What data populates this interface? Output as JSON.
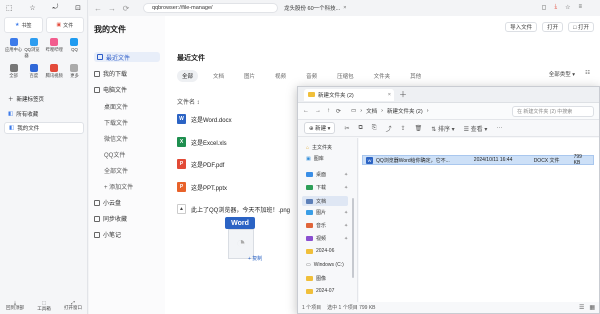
{
  "browser": {
    "address": "qqbrowser://file-manage/",
    "tab_title": "龙头股份 60一个科技...",
    "topright": {
      "wallet": "◻",
      "download": "⤓",
      "history": "☆",
      "menu": "≡"
    }
  },
  "sidebar": {
    "top_icons": [
      "⬚",
      "☆",
      "⤾",
      "⊡"
    ],
    "big_buttons": [
      {
        "icon": "★",
        "label": "书签"
      },
      {
        "icon": "▣",
        "label": "文件"
      }
    ],
    "row1": [
      {
        "label": "应用中心",
        "color": "#3d7bea"
      },
      {
        "label": "QQ浏览器",
        "color": "#2d9df0"
      },
      {
        "label": "哔哩哔哩",
        "color": "#f25d8e"
      },
      {
        "label": "QQ",
        "color": "#1f9bf0"
      }
    ],
    "row2": [
      {
        "label": "全部",
        "color": "#555"
      },
      {
        "label": "百度",
        "color": "#3068d8"
      },
      {
        "label": "腾讯视频",
        "color": "#e34a3a"
      },
      {
        "label": "更多",
        "color": "#777"
      }
    ],
    "new_tab": "新建标签页",
    "tabs": [
      {
        "label": "所有收藏"
      },
      {
        "label": "我的文件"
      }
    ],
    "bottom": [
      {
        "icon": "⤓",
        "label": "回到顶部"
      },
      {
        "icon": "⬚",
        "label": "工具箱"
      },
      {
        "icon": "⤢",
        "label": "打开窗口"
      }
    ]
  },
  "fm": {
    "title": "我的文件",
    "nav": [
      {
        "label": "最近文件",
        "selected": true,
        "sub": false
      },
      {
        "label": "我的下载",
        "selected": false,
        "sub": false
      },
      {
        "label": "电脑文件",
        "selected": false,
        "sub": false
      },
      {
        "label": "桌面文件",
        "selected": false,
        "sub": true
      },
      {
        "label": "下载文件",
        "selected": false,
        "sub": true
      },
      {
        "label": "微信文件",
        "selected": false,
        "sub": true
      },
      {
        "label": "QQ文件",
        "selected": false,
        "sub": true
      },
      {
        "label": "全部文件",
        "selected": false,
        "sub": true
      },
      {
        "label": "+ 添加文件",
        "selected": false,
        "sub": true
      },
      {
        "label": "小云盘",
        "selected": false,
        "sub": false
      },
      {
        "label": "同步收藏",
        "selected": false,
        "sub": false
      },
      {
        "label": "小笔记",
        "selected": false,
        "sub": false
      }
    ],
    "top_buttons": [
      {
        "label": "导入文件",
        "blue": false
      },
      {
        "label": "打开",
        "blue": false
      },
      {
        "label": "□ 打开",
        "blue": false
      }
    ],
    "recent_title": "最近文件",
    "filter_tabs": [
      "全部",
      "文档",
      "图片",
      "视频",
      "音频",
      "压缩包",
      "文件夹",
      "其他"
    ],
    "sort_label": "全部类型 ▾",
    "view_icon": "☷",
    "files_head": "文件名 ↕",
    "files": [
      {
        "name": "这是Word.docx",
        "letter": "W",
        "color": "#2b63c4"
      },
      {
        "name": "这是Excel.xls",
        "letter": "X",
        "color": "#1e8f4f"
      },
      {
        "name": "这是PDF.pdf",
        "letter": "P",
        "color": "#e24a36"
      },
      {
        "name": "这是PPT.pptx",
        "letter": "P",
        "color": "#e8622a"
      },
      {
        "name": "此上了QQ浏览器，今天不加班！.png",
        "letter": "▲",
        "color": "#555"
      }
    ],
    "drag": {
      "word_label": "Word",
      "copy_label": "+ 复制"
    }
  },
  "explorer": {
    "tab_title": "新建文件夹 (2)",
    "nav_icons": [
      "←",
      "→",
      "↑",
      "⟳"
    ],
    "path": [
      "›",
      "文档",
      "›",
      "新建文件夹 (2)",
      "›"
    ],
    "search_placeholder": "在 新建文件夹 (2) 中搜索",
    "tools": [
      "⊕ 新建 ▾",
      "✂",
      "⧉",
      "⎘",
      "⤴",
      "⇪",
      "🗑",
      "⇅ 排序 ▾",
      "☰ 查看 ▾",
      "···"
    ],
    "nav_pane": [
      {
        "label": "主文件夹",
        "kind": "home"
      },
      {
        "label": "图库",
        "kind": "gallery"
      },
      {
        "label": "桌面",
        "kind": "folder"
      },
      {
        "label": "下载",
        "kind": "folder"
      },
      {
        "label": "文档",
        "kind": "folder",
        "selected": true
      },
      {
        "label": "图片",
        "kind": "folder"
      },
      {
        "label": "音乐",
        "kind": "folder"
      },
      {
        "label": "视频",
        "kind": "folder"
      },
      {
        "label": "2024-06",
        "kind": "folder"
      },
      {
        "label": "Windows (C:)",
        "kind": "drive"
      },
      {
        "label": "图像",
        "kind": "folder"
      },
      {
        "label": "2024-07",
        "kind": "folder"
      }
    ],
    "file_row": {
      "name": "QQ浏览器Word给你确定，它不...",
      "date": "2024/10/11 16:44",
      "type": "DOCX 文件",
      "size": "799 KB"
    },
    "status": [
      "1 个项目",
      "选中 1 个项目 799 KB"
    ],
    "view_icons": [
      "☰",
      "▦"
    ]
  }
}
